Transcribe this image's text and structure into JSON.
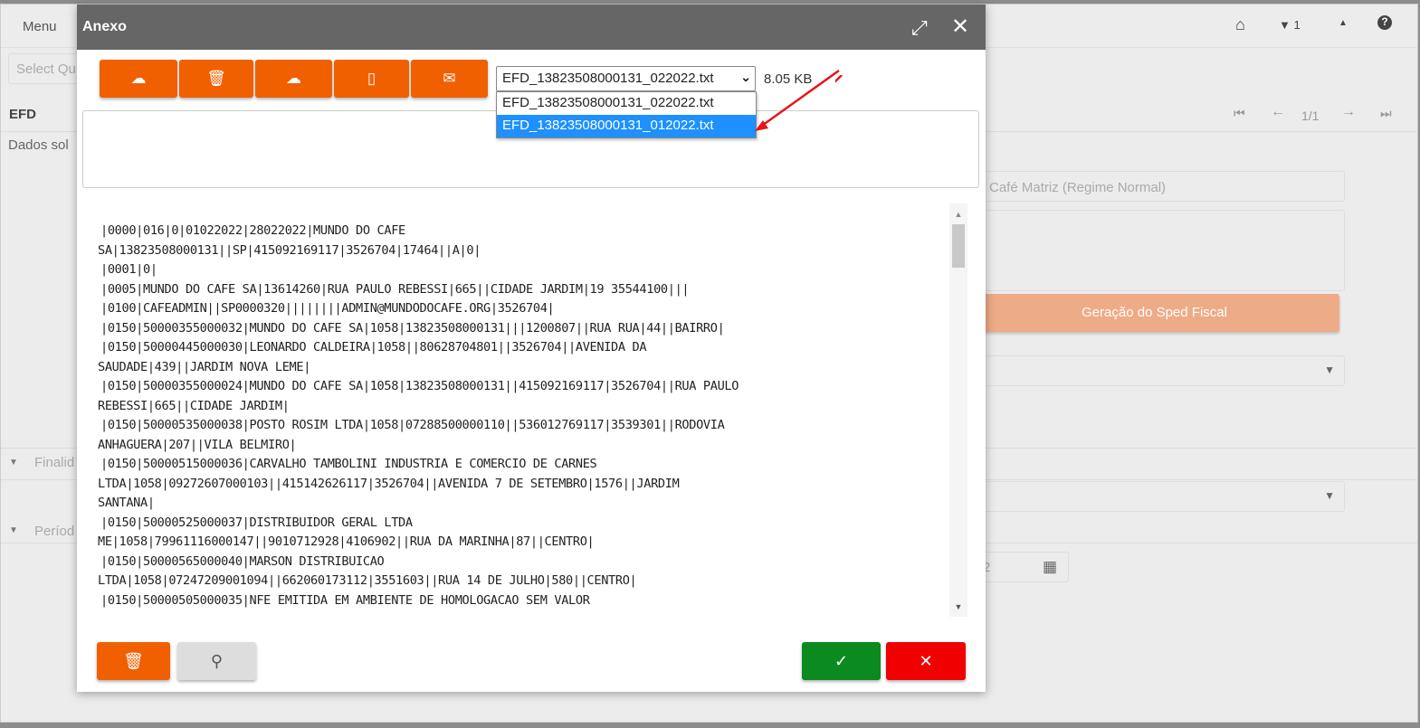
{
  "background": {
    "menu_label": "Menu",
    "select_placeholder": "Select Qu",
    "section_title": "EFD",
    "section_subtitle": "Dados sol",
    "pagination": "1/1",
    "user_count": "1",
    "company_field": "Café Matriz (Regime Normal)",
    "generate_button": "Geração do Sped Fiscal",
    "group_finalidade": "Finalid",
    "group_periodo": "Períod",
    "date_fragment": "2"
  },
  "modal": {
    "title": "Anexo",
    "toolbar_icons": [
      "upload-icon",
      "trash-icon",
      "download-icon",
      "zip-file-icon",
      "envelope-icon"
    ],
    "file_select": {
      "selected": "EFD_13823508000131_022022.txt",
      "options": [
        "EFD_13823508000131_022022.txt",
        "EFD_13823508000131_012022.txt"
      ],
      "highlighted": "EFD_13823508000131_012022.txt"
    },
    "file_size": "8.05 KB",
    "description": "",
    "file_lines": [
      "|0000|016|0|01022022|28022022|MUNDO DO CAFE",
      "SA|13823508000131||SP|415092169117|3526704|17464||A|0|",
      "|0001|0|",
      "|0005|MUNDO DO CAFE SA|13614260|RUA PAULO REBESSI|665||CIDADE JARDIM|19 35544100|||",
      "|0100|CAFEADMIN||SP0000320||||||||ADMIN@MUNDODOCAFE.ORG|3526704|",
      "|0150|50000355000032|MUNDO DO CAFE SA|1058|13823508000131|||1200807||RUA RUA|44||BAIRRO|",
      "|0150|50000445000030|LEONARDO CALDEIRA|1058||80628704801||3526704||AVENIDA DA",
      "SAUDADE|439||JARDIM NOVA LEME|",
      "|0150|50000355000024|MUNDO DO CAFE SA|1058|13823508000131||415092169117|3526704||RUA PAULO",
      "REBESSI|665||CIDADE JARDIM|",
      "|0150|50000535000038|POSTO ROSIM LTDA|1058|07288500000110||536012769117|3539301||RODOVIA",
      "ANHAGUERA|207||VILA BELMIRO|",
      "|0150|50000515000036|CARVALHO TAMBOLINI INDUSTRIA E COMERCIO DE CARNES",
      "LTDA|1058|09272607000103||415142626117|3526704||AVENIDA 7 DE SETEMBRO|1576||JARDIM",
      "SANTANA|",
      "|0150|50000525000037|DISTRIBUIDOR GERAL LTDA",
      "ME|1058|79961116000147||9010712928|4106902||RUA DA MARINHA|87||CENTRO|",
      "|0150|50000565000040|MARSON DISTRIBUICAO",
      "LTDA|1058|07247209001094||662060173112|3551603||RUA 14 DE JULHO|580||CENTRO|",
      "|0150|50000505000035|NFE EMITIDA EM AMBIENTE DE HOMOLOGACAO SEM VALOR"
    ],
    "footer_icons": [
      "trash-icon",
      "search-icon",
      "check-icon",
      "close-icon"
    ],
    "colors": {
      "orange": "#f06000",
      "green": "#0a8a1f",
      "red": "#f00000",
      "header": "#666666",
      "highlight": "#1e90ff"
    }
  }
}
